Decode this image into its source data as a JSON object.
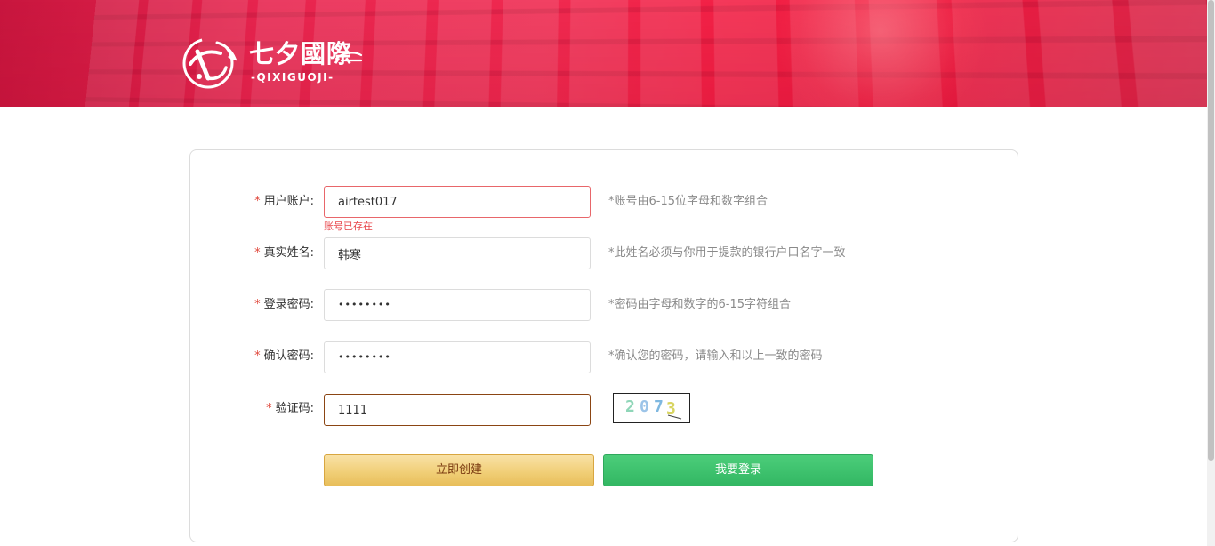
{
  "header": {
    "logo_cn": "七夕國際",
    "logo_en": "-QIXIGUOJI-"
  },
  "form": {
    "username": {
      "label": "用户账户:",
      "value": "airtest017",
      "hint": "*账号由6-15位字母和数字组合",
      "error": "账号已存在"
    },
    "realname": {
      "label": "真实姓名:",
      "value": "韩寒",
      "hint": "*此姓名必须与你用于提款的银行户口名字一致"
    },
    "password": {
      "label": "登录密码:",
      "value": "••••••••",
      "hint": "*密码由字母和数字的6-15字符组合"
    },
    "confirm": {
      "label": "确认密码:",
      "value": "••••••••",
      "hint": "*确认您的密码，请输入和以上一致的密码"
    },
    "captcha": {
      "label": "验证码:",
      "value": "1111",
      "image_digits": [
        "2",
        "0",
        "7",
        "3"
      ],
      "digit_colors": [
        "#8fd6b8",
        "#9cc4e8",
        "#7fb8e0",
        "#d8d460"
      ]
    },
    "required_mark": "*"
  },
  "buttons": {
    "create": "立即创建",
    "login": "我要登录"
  },
  "colors": {
    "banner": "#f02a50",
    "create_button": "#f1cf78",
    "login_button": "#3cc06c",
    "error_text": "#e8454a"
  }
}
